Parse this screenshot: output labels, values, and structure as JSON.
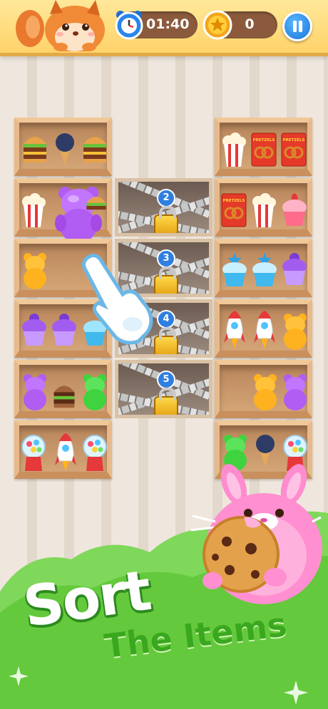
{
  "hud": {
    "timer": "01:40",
    "coins": "0",
    "icons": {
      "avatar": "squirrel-avatar",
      "timer": "alarm-clock-icon",
      "coin": "star-coin-icon",
      "pause": "pause-icon"
    }
  },
  "locks": [
    {
      "number": "2"
    },
    {
      "number": "3"
    },
    {
      "number": "4"
    },
    {
      "number": "5"
    }
  ],
  "product_labels": {
    "pretzels": "PRETZELS"
  },
  "shelves_left": [
    [
      "burger",
      "ice-cream-cone",
      "burger"
    ],
    [
      "popcorn",
      "purple-gummy-bear",
      "burger"
    ],
    [
      "orange-gummy-bear",
      "purple-gummy-bear"
    ],
    [
      "purple-cupcake",
      "purple-cupcake",
      "blue-cupcake"
    ],
    [
      "purple-gummy-bear",
      "burger",
      "green-gummy-bear"
    ],
    [
      "gumball-machine",
      "rocket",
      "gumball-machine"
    ]
  ],
  "shelves_right": [
    [
      "popcorn",
      "pretzels",
      "pretzels"
    ],
    [
      "pretzels",
      "popcorn",
      "strawberry-cupcake"
    ],
    [
      "blue-cupcake",
      "blue-cupcake",
      "purple-cupcake"
    ],
    [
      "rocket",
      "rocket",
      "orange-gummy-bear"
    ],
    [
      "orange-gummy-bear",
      "purple-gummy-bear"
    ],
    [
      "green-gummy-bear",
      "ice-cream-cone",
      "gumball-machine"
    ]
  ],
  "title": {
    "line1": "Sort",
    "line2": "The Items"
  },
  "colors": {
    "topbar": "#ffd36a",
    "green": "#6fd04a",
    "lock_badge": "#2f7fe0"
  }
}
